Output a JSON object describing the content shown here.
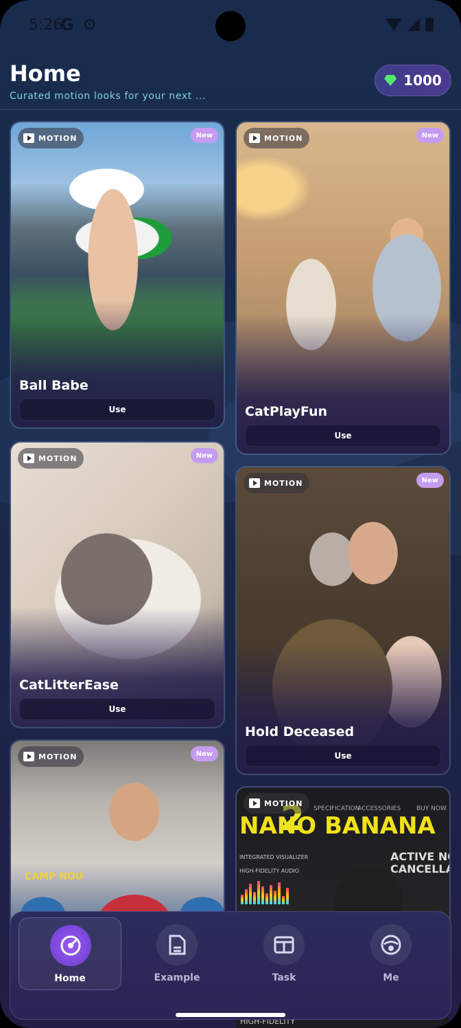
{
  "status": {
    "time": "5:26",
    "g_icon": "G"
  },
  "header": {
    "title": "Home",
    "subtitle": "Curated motion looks for your next ...",
    "gems": "1000"
  },
  "cards": [
    {
      "tag": "MOTION",
      "badge": "New",
      "title": "Ball Babe",
      "button": "Use"
    },
    {
      "tag": "MOTION",
      "badge": "New",
      "title": "CatPlayFun",
      "button": "Use"
    },
    {
      "tag": "MOTION",
      "badge": "New",
      "title": "CatLitterEase",
      "button": "Use"
    },
    {
      "tag": "MOTION",
      "badge": "New",
      "title": "Hold Deceased",
      "button": "Use"
    },
    {
      "tag": "MOTION",
      "badge": "New"
    },
    {
      "tag": "MOTION"
    }
  ],
  "nano": {
    "big": "NANO BANANA",
    "num": "2",
    "nav_spec": "SPECIFICATION",
    "nav_acc": "ACCESSORIES",
    "nav_buy": "BUY NOW",
    "left1": "INTEGRATED VISUALIZER",
    "left2": "HIGH-FIDELITY AUDIO",
    "right1": "ACTIVE NOISE",
    "right2": "CANCELLATION"
  },
  "baseball": {
    "camp": "CAMP NOU"
  },
  "nav": [
    {
      "label": "Home",
      "icon": "compass-icon",
      "active": true
    },
    {
      "label": "Example",
      "icon": "document-icon",
      "active": false
    },
    {
      "label": "Task",
      "icon": "task-box-icon",
      "active": false
    },
    {
      "label": "Me",
      "icon": "profile-icon",
      "active": false
    }
  ],
  "footer_peek": "HIGH-FIDELITY",
  "colors": {
    "accent": "#9a5cf0",
    "gem": "#52e86a",
    "subtitle": "#7ed0e0",
    "badge": "#c59cf0"
  }
}
